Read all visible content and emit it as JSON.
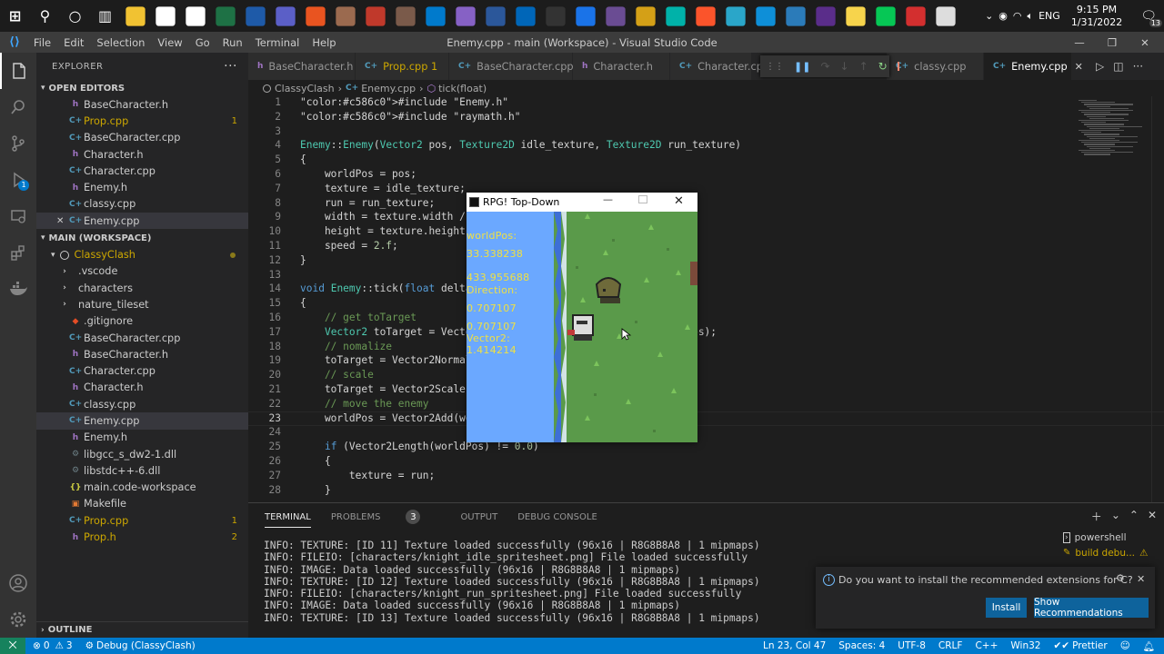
{
  "taskbar": {
    "icons": [
      "windows",
      "search",
      "cortana",
      "task-view",
      "file-explorer",
      "notepad",
      "docs",
      "excel",
      "r-studio",
      "mail",
      "ubuntu",
      "photo",
      "car",
      "person",
      "vscode",
      "visual-studio",
      "word",
      "powershell",
      "terminal",
      "maps",
      "obs",
      "audition",
      "lightning",
      "brave",
      "keyboard-tool",
      "edge",
      "app-window",
      "urh",
      "sticky-notes",
      "line",
      "record",
      "notepad-window"
    ],
    "tray_lang": "ENG",
    "time": "9:15 PM",
    "date": "1/31/2022",
    "notif_count": "13"
  },
  "titlebar": {
    "menu": [
      "File",
      "Edit",
      "Selection",
      "View",
      "Go",
      "Run",
      "Terminal",
      "Help"
    ],
    "title": "Enemy.cpp - main (Workspace) - Visual Studio Code"
  },
  "explorer": {
    "header": "EXPLORER",
    "open_editors_label": "OPEN EDITORS",
    "open_editors": [
      {
        "name": "BaseCharacter.h",
        "type": "h",
        "badge": ""
      },
      {
        "name": "Prop.cpp",
        "type": "cpp",
        "badge": "1",
        "warn": true
      },
      {
        "name": "BaseCharacter.cpp",
        "type": "cpp",
        "badge": ""
      },
      {
        "name": "Character.h",
        "type": "h",
        "badge": ""
      },
      {
        "name": "Character.cpp",
        "type": "cpp",
        "badge": ""
      },
      {
        "name": "Enemy.h",
        "type": "h",
        "badge": ""
      },
      {
        "name": "classy.cpp",
        "type": "cpp",
        "badge": ""
      },
      {
        "name": "Enemy.cpp",
        "type": "cpp",
        "badge": "",
        "active": true
      }
    ],
    "workspace_label": "MAIN (WORKSPACE)",
    "folder": "ClassyClash",
    "files": [
      {
        "name": ".vscode",
        "type": "folder"
      },
      {
        "name": "characters",
        "type": "folder"
      },
      {
        "name": "nature_tileset",
        "type": "folder"
      },
      {
        "name": ".gitignore",
        "type": "git"
      },
      {
        "name": "BaseCharacter.cpp",
        "type": "cpp"
      },
      {
        "name": "BaseCharacter.h",
        "type": "h"
      },
      {
        "name": "Character.cpp",
        "type": "cpp"
      },
      {
        "name": "Character.h",
        "type": "h"
      },
      {
        "name": "classy.cpp",
        "type": "cpp"
      },
      {
        "name": "Enemy.cpp",
        "type": "cpp",
        "active": true
      },
      {
        "name": "Enemy.h",
        "type": "h"
      },
      {
        "name": "libgcc_s_dw2-1.dll",
        "type": "dll"
      },
      {
        "name": "libstdc++-6.dll",
        "type": "dll"
      },
      {
        "name": "main.code-workspace",
        "type": "json"
      },
      {
        "name": "Makefile",
        "type": "make"
      },
      {
        "name": "Prop.cpp",
        "type": "cpp",
        "badge": "1",
        "warn": true
      },
      {
        "name": "Prop.h",
        "type": "h",
        "badge": "2",
        "warn": true
      }
    ],
    "outline_label": "OUTLINE"
  },
  "tabs": [
    {
      "name": "BaseCharacter.h",
      "type": "h"
    },
    {
      "name": "Prop.cpp 1",
      "type": "cpp",
      "warn": true
    },
    {
      "name": "BaseCharacter.cpp",
      "type": "cpp"
    },
    {
      "name": "Character.h",
      "type": "h"
    },
    {
      "name": "Character.cp",
      "type": "cpp"
    },
    {
      "name": "classy.cpp",
      "type": "cpp"
    },
    {
      "name": "Enemy.cpp",
      "type": "cpp",
      "active": true
    }
  ],
  "breadcrumb": [
    "ClassyClash",
    "Enemy.cpp",
    "tick(float)"
  ],
  "code": {
    "current_line": 23,
    "lines": [
      {
        "n": "1",
        "t": "#include \"Enemy.h\""
      },
      {
        "n": "2",
        "t": "#include \"raymath.h\""
      },
      {
        "n": "3",
        "t": ""
      },
      {
        "n": "4",
        "t": "Enemy::Enemy(Vector2 pos, Texture2D idle_texture, Texture2D run_texture)"
      },
      {
        "n": "5",
        "t": "{"
      },
      {
        "n": "6",
        "t": "    worldPos = pos;"
      },
      {
        "n": "7",
        "t": "    texture = idle_texture;"
      },
      {
        "n": "8",
        "t": "    run = run_texture;"
      },
      {
        "n": "9",
        "t": "    width = texture.width / m"
      },
      {
        "n": "10",
        "t": "    height = texture.height;"
      },
      {
        "n": "11",
        "t": "    speed = 2.f;"
      },
      {
        "n": "12",
        "t": "}"
      },
      {
        "n": "13",
        "t": ""
      },
      {
        "n": "14",
        "t": "void Enemy::tick(float delta"
      },
      {
        "n": "15",
        "t": "{"
      },
      {
        "n": "16",
        "t": "    // get toTarget"
      },
      {
        "n": "17",
        "t": "    Vector2 toTarget = Vecto                                  nPos);"
      },
      {
        "n": "18",
        "t": "    // nomalize"
      },
      {
        "n": "19",
        "t": "    toTarget = Vector2Normali"
      },
      {
        "n": "20",
        "t": "    // scale"
      },
      {
        "n": "21",
        "t": "    toTarget = Vector2Scale(t"
      },
      {
        "n": "22",
        "t": "    // move the enemy"
      },
      {
        "n": "23",
        "t": "    worldPos = Vector2Add(wor"
      },
      {
        "n": "24",
        "t": ""
      },
      {
        "n": "25",
        "t": "    if (Vector2Length(worldPos) != 0.0)"
      },
      {
        "n": "26",
        "t": "    {"
      },
      {
        "n": "27",
        "t": "        texture = run;"
      },
      {
        "n": "28",
        "t": "    }"
      }
    ]
  },
  "game": {
    "title": "RPG! Top-Down",
    "texts": [
      "worldPos:",
      "33.338238",
      "433.955688",
      "Direction:",
      "0.707107",
      "0.707107",
      "Vector2:",
      "1.414214"
    ]
  },
  "panel": {
    "tabs": [
      "TERMINAL",
      "PROBLEMS",
      "OUTPUT",
      "DEBUG CONSOLE"
    ],
    "problems_count": "3",
    "terminals": [
      "powershell",
      "build debu..."
    ],
    "lines": [
      "INFO: TEXTURE: [ID 11] Texture loaded successfully (96x16 | R8G8B8A8 | 1 mipmaps)",
      "INFO: FILEIO: [characters/knight_idle_spritesheet.png] File loaded successfully",
      "INFO: IMAGE: Data loaded successfully (96x16 | R8G8B8A8 | 1 mipmaps)",
      "INFO: TEXTURE: [ID 12] Texture loaded successfully (96x16 | R8G8B8A8 | 1 mipmaps)",
      "INFO: FILEIO: [characters/knight_run_spritesheet.png] File loaded successfully",
      "INFO: IMAGE: Data loaded successfully (96x16 | R8G8B8A8 | 1 mipmaps)",
      "INFO: TEXTURE: [ID 13] Texture loaded successfully (96x16 | R8G8B8A8 | 1 mipmaps)"
    ]
  },
  "notification": {
    "message": "Do you want to install the recommended extensions for C?",
    "install": "Install",
    "show": "Show Recommendations"
  },
  "status": {
    "errors": "0",
    "warnings": "3",
    "debug": "Debug (ClassyClash)",
    "position": "Ln 23, Col 47",
    "spaces": "Spaces: 4",
    "encoding": "UTF-8",
    "eol": "CRLF",
    "language": "C++",
    "platform": "Win32",
    "formatter": "Prettier"
  },
  "colors": {
    "accent": "#007acc",
    "cpp": "#519aba",
    "h": "#a074c4",
    "warn": "#cca700"
  }
}
